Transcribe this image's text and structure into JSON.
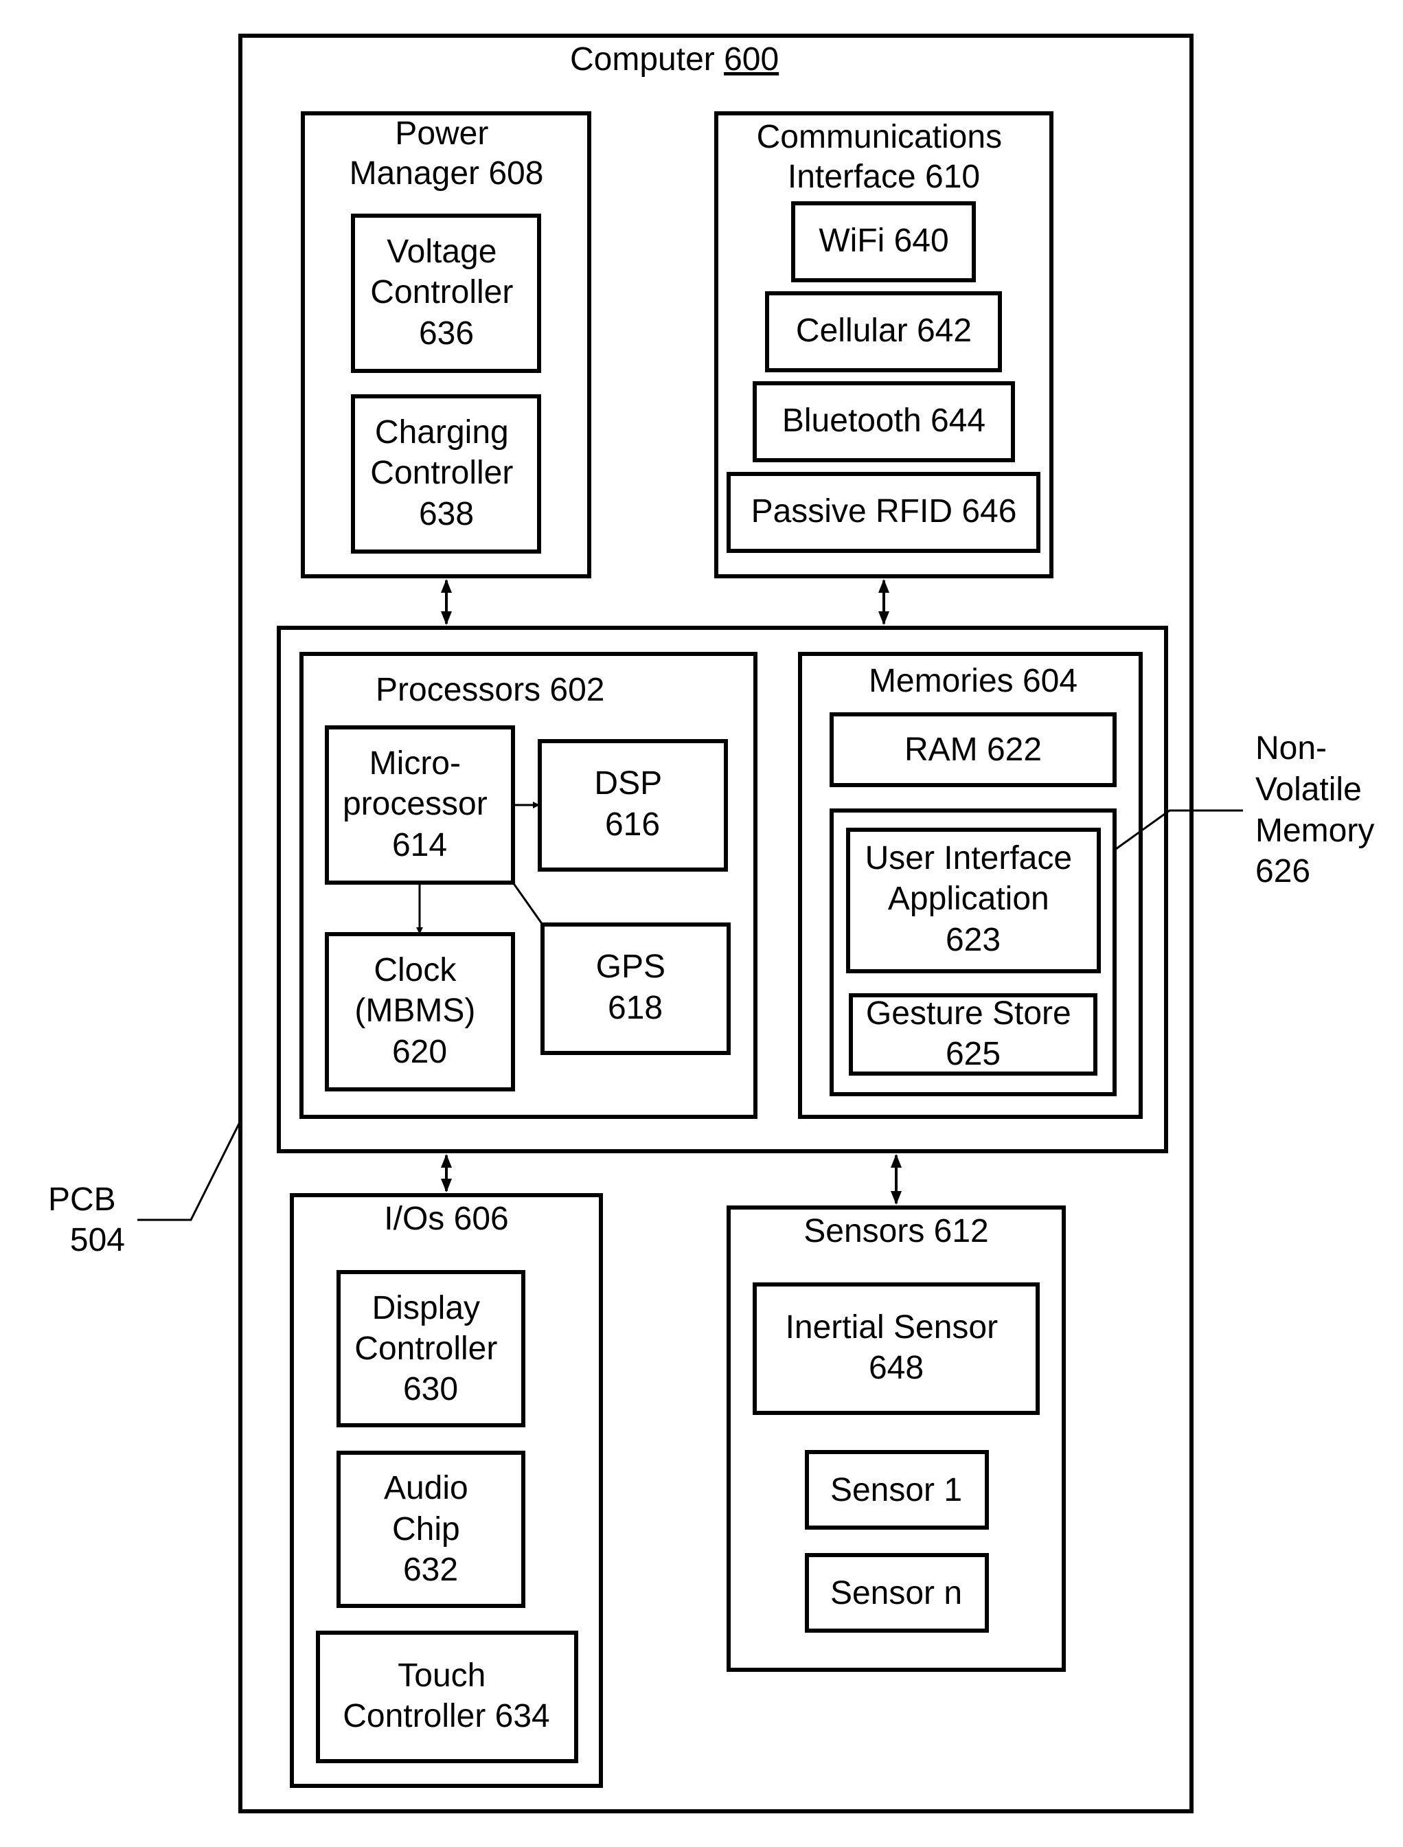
{
  "computer": {
    "label": "Computer ",
    "number": "600"
  },
  "power_manager": {
    "lines": [
      "Power",
      "Manager 608"
    ]
  },
  "voltage_controller": {
    "lines": [
      "Voltage",
      "Controller",
      "636"
    ]
  },
  "charging_controller": {
    "lines": [
      "Charging",
      "Controller",
      "638"
    ]
  },
  "comms": {
    "lines": [
      "Communications",
      "Interface 610"
    ]
  },
  "wifi": "WiFi 640",
  "cellular": "Cellular 642",
  "bluetooth": "Bluetooth 644",
  "rfid": "Passive RFID 646",
  "processors": "Processors 602",
  "microprocessor": {
    "lines": [
      "Micro-",
      "processor",
      "614"
    ]
  },
  "dsp": {
    "lines": [
      "DSP",
      "616"
    ]
  },
  "clock": {
    "lines": [
      "Clock",
      "(MBMS)",
      "620"
    ]
  },
  "gps": {
    "lines": [
      "GPS",
      "618"
    ]
  },
  "memories": "Memories 604",
  "ram": "RAM 622",
  "ui_app": {
    "lines": [
      "User Interface",
      "Application",
      "623"
    ]
  },
  "gesture_store": {
    "lines": [
      "Gesture Store",
      "625"
    ]
  },
  "nvm": {
    "lines": [
      "Non-",
      "Volatile",
      "Memory",
      "626"
    ]
  },
  "pcb": {
    "lines": [
      "PCB",
      "504"
    ]
  },
  "ios": "I/Os 606",
  "display_controller": {
    "lines": [
      "Display",
      "Controller",
      "630"
    ]
  },
  "audio_chip": {
    "lines": [
      "Audio",
      "Chip",
      "632"
    ]
  },
  "touch_controller": {
    "lines": [
      "Touch",
      "Controller 634"
    ]
  },
  "sensors": "Sensors 612",
  "inertial_sensor": {
    "lines": [
      "Inertial Sensor",
      "648"
    ]
  },
  "sensor1": "Sensor 1",
  "sensorn": "Sensor n"
}
